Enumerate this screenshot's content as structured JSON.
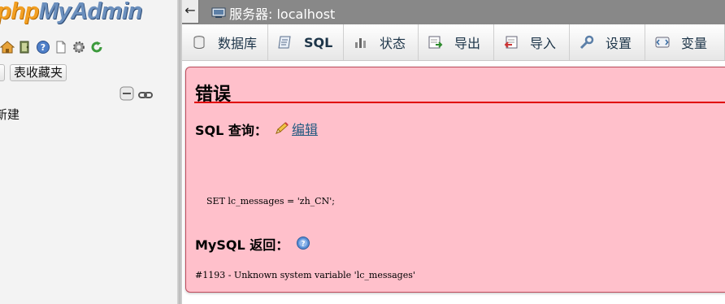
{
  "nav": {
    "logo_part1": "php",
    "logo_part2": "MyAdmin",
    "icons": [
      "home-icon",
      "exit-icon",
      "help-icon",
      "docs-icon",
      "settings-icon",
      "reload-icon"
    ],
    "favorites_label": "表收藏夹",
    "new_db_label": "新建"
  },
  "topbar": {
    "back_arrow": "←",
    "server_label": "服务器: localhost"
  },
  "tabs": [
    {
      "label": "数据库",
      "icon": "database-icon"
    },
    {
      "label": "SQL",
      "icon": "sql-icon"
    },
    {
      "label": "状态",
      "icon": "status-icon"
    },
    {
      "label": "导出",
      "icon": "export-icon"
    },
    {
      "label": "导入",
      "icon": "import-icon"
    },
    {
      "label": "设置",
      "icon": "wrench-icon"
    },
    {
      "label": "变量",
      "icon": "variables-icon"
    }
  ],
  "error": {
    "title": "错误",
    "sql_query_label": "SQL 查询：",
    "edit_link": "编辑",
    "query": "SET lc_messages = 'zh_CN';",
    "mysql_returned_label": "MySQL 返回：",
    "message": "#1193 - Unknown system variable 'lc_messages'"
  },
  "colors": {
    "error_background": "#ffc0cb",
    "error_rule": "#e00000",
    "topbar": "#888888",
    "link": "#235a81"
  }
}
